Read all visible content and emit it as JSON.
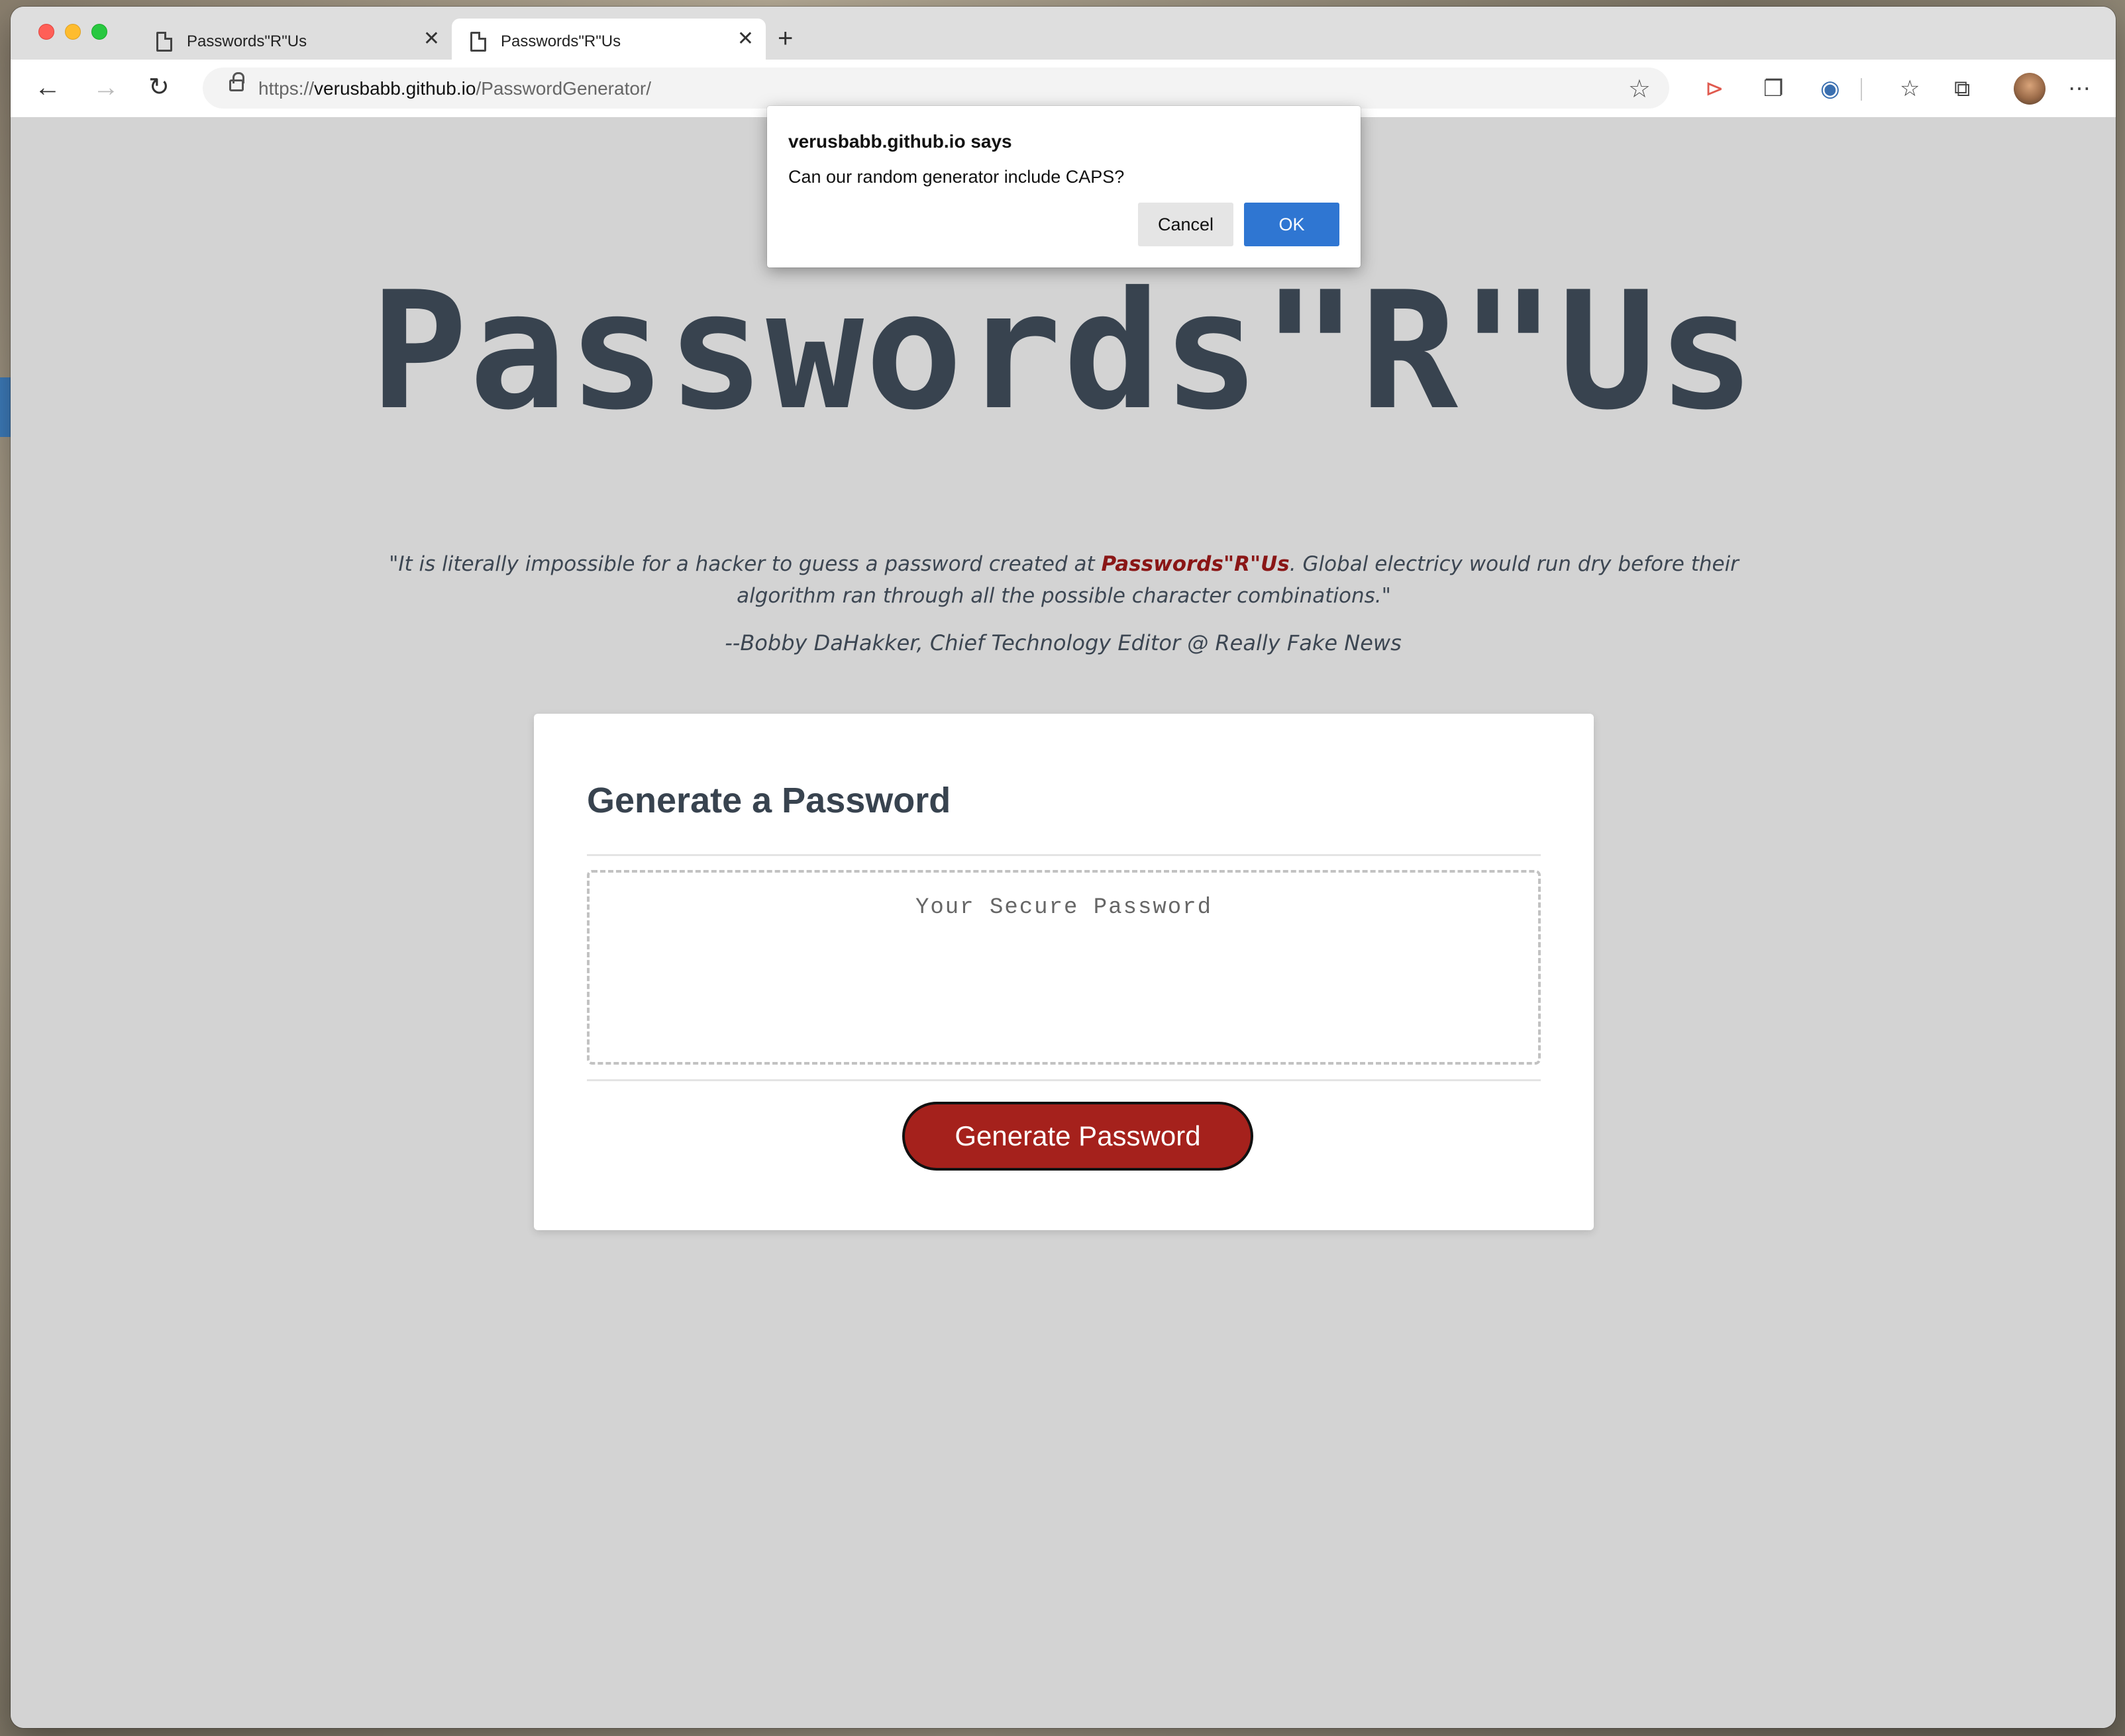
{
  "browser": {
    "tabs": [
      {
        "title": "Passwords\"R\"Us",
        "active": false
      },
      {
        "title": "Passwords\"R\"Us",
        "active": true
      }
    ],
    "url_scheme": "https://",
    "url_host": "verusbabb.github.io",
    "url_path": "/PasswordGenerator/",
    "icons": {
      "back": "back-arrow-icon",
      "forward": "forward-arrow-icon",
      "reload": "reload-icon",
      "favorite": "star-icon",
      "extensions": [
        "share-icon",
        "copy-icon",
        "password-manager-icon",
        "favorites-icon",
        "collections-icon",
        "profile-avatar",
        "more-icon"
      ]
    }
  },
  "dialog": {
    "title": "verusbabb.github.io says",
    "message": "Can our random generator include CAPS?",
    "cancel_label": "Cancel",
    "ok_label": "OK",
    "ok_color": "#2f76d2"
  },
  "page": {
    "title": "Passwords\"R\"Us",
    "quote_before": "\"It is literally impossible for a hacker to guess a password created at ",
    "quote_brand": "Passwords\"R\"Us",
    "quote_after": ". Global electricy would run dry before their algorithm ran through all the possible character combinations.\"",
    "attribution": "--Bobby DaHakker, Chief Technology Editor @ Really Fake News",
    "brand_color": "#8a1616"
  },
  "card": {
    "title": "Generate a Password",
    "password_placeholder": "Your Secure Password",
    "password_value": "",
    "generate_label": "Generate Password",
    "button_color": "#a5211c"
  }
}
